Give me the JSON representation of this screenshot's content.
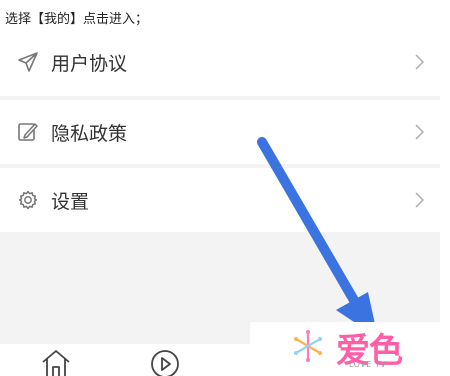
{
  "instruction_text": "选择【我的】点击进入；",
  "menu": {
    "items": [
      {
        "label": "用户协议",
        "icon": "send-icon"
      },
      {
        "label": "隐私政策",
        "icon": "edit-icon"
      },
      {
        "label": "设置",
        "icon": "gear-icon"
      }
    ],
    "chevron": "chevron-right-icon"
  },
  "tabbar": {
    "items": [
      {
        "icon": "home-icon"
      },
      {
        "icon": "play-icon"
      }
    ]
  },
  "watermark": {
    "logo_text": "爱色",
    "sub_text": "LOVE TV"
  },
  "colors": {
    "arrow": "#3b73e0",
    "panel_bg": "#f3f3f3",
    "text": "#333333",
    "icon": "#777777",
    "chevron": "#b5b5b5",
    "watermark_pink": "#ff5ea8"
  }
}
